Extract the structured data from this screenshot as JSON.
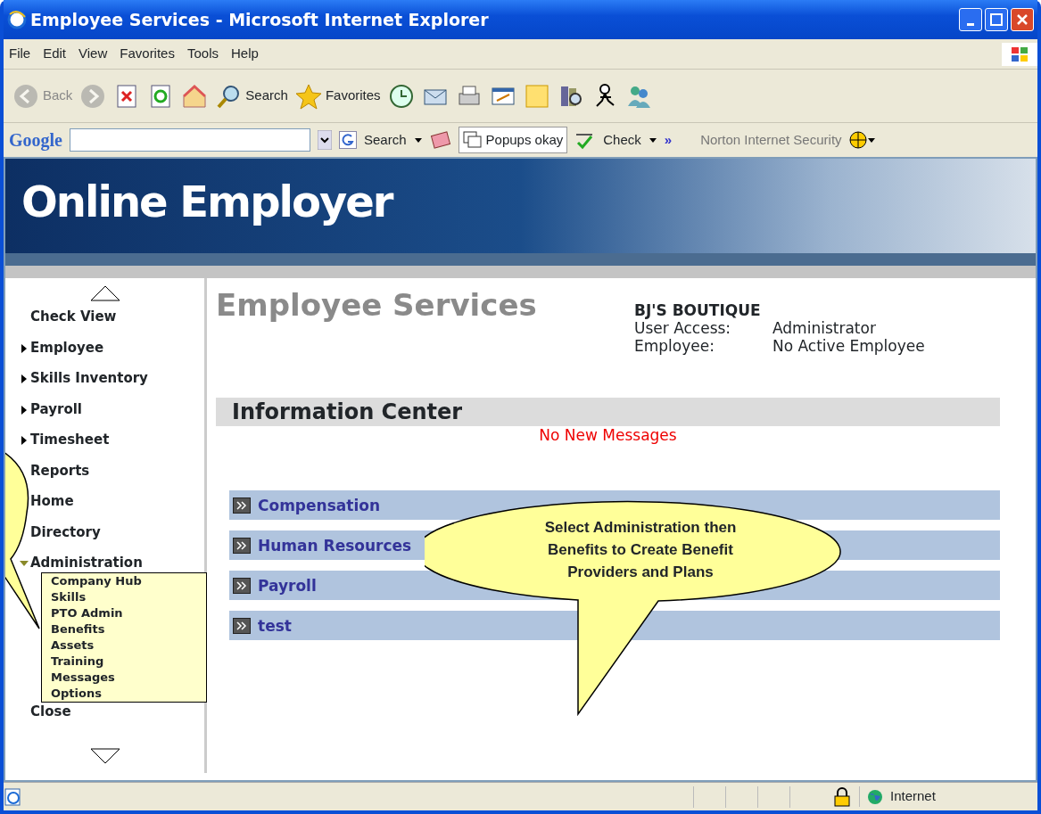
{
  "window": {
    "title": "Employee Services - Microsoft Internet Explorer"
  },
  "menu_bar": [
    "File",
    "Edit",
    "View",
    "Favorites",
    "Tools",
    "Help"
  ],
  "toolbar": [
    {
      "kind": "back",
      "label": "Back",
      "disabled": true
    },
    {
      "kind": "forward",
      "disabled": true
    },
    {
      "kind": "stop"
    },
    {
      "kind": "refresh"
    },
    {
      "kind": "home"
    },
    {
      "kind": "search",
      "label": "Search"
    },
    {
      "kind": "favorites",
      "label": "Favorites"
    },
    {
      "kind": "history"
    },
    {
      "kind": "mail"
    },
    {
      "kind": "print"
    },
    {
      "kind": "edit"
    },
    {
      "kind": "note"
    },
    {
      "kind": "research"
    },
    {
      "kind": "messenger"
    },
    {
      "kind": "contacts"
    }
  ],
  "google_bar": {
    "logo": "Google",
    "search_label": "Search",
    "popups": "Popups okay",
    "check": "Check",
    "more": "»",
    "norton": "Norton Internet Security"
  },
  "banner": {
    "title": "Online Employer"
  },
  "sidebar": {
    "items": [
      {
        "kind": "link",
        "label": "Check View"
      },
      {
        "kind": "group",
        "label": "Employee",
        "expanded": false
      },
      {
        "kind": "group",
        "label": "Skills Inventory",
        "expanded": false
      },
      {
        "kind": "group",
        "label": "Payroll",
        "expanded": false
      },
      {
        "kind": "group",
        "label": "Timesheet",
        "expanded": false
      },
      {
        "kind": "link",
        "label": "Reports"
      },
      {
        "kind": "link",
        "label": "Home"
      },
      {
        "kind": "link",
        "label": "Directory"
      },
      {
        "kind": "group",
        "label": "Administration",
        "expanded": true,
        "children": [
          {
            "label": "Company Hub"
          },
          {
            "label": "Skills"
          },
          {
            "label": "PTO Admin"
          },
          {
            "label": "Benefits"
          },
          {
            "label": "Assets"
          },
          {
            "label": "Training"
          },
          {
            "label": "Messages"
          },
          {
            "label": "Options"
          }
        ]
      },
      {
        "kind": "link",
        "label": "Close"
      }
    ]
  },
  "main": {
    "title": "Employee Services",
    "company": {
      "name": "BJ'S BOUTIQUE",
      "fields": [
        {
          "label": "User Access:",
          "value": "Administrator"
        },
        {
          "label": "Employee:",
          "value": "No Active Employee"
        }
      ]
    },
    "info_center": {
      "title": "Information Center",
      "message": "No New Messages"
    },
    "sections": [
      "Compensation",
      "Human Resources",
      "Payroll",
      "test"
    ]
  },
  "callout": {
    "text": "Select Administration then Benefits to Create Benefit Providers and Plans"
  },
  "status_bar": {
    "zone": "Internet"
  }
}
